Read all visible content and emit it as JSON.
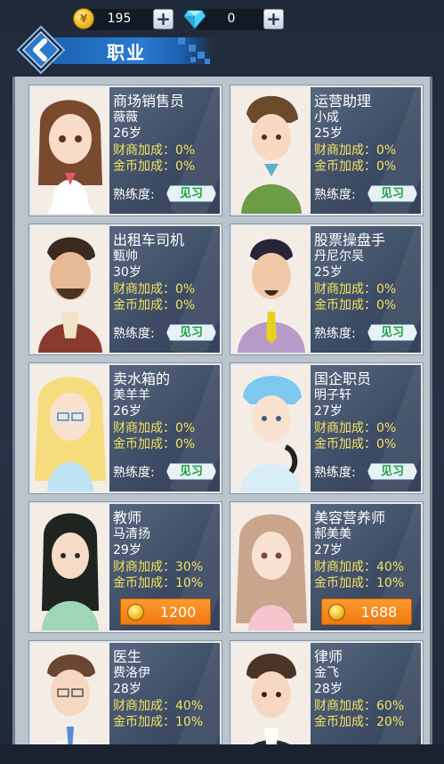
{
  "header": {
    "gold": "195",
    "diamond": "0",
    "title": "职业"
  },
  "jobs": [
    {
      "job": "商场销售员",
      "name": "薇薇",
      "age": "26岁",
      "stat1": "财商加成：0%",
      "stat2": "金币加成：0%",
      "prof_label": "熟练度:",
      "badge": "见习"
    },
    {
      "job": "运营助理",
      "name": "小成",
      "age": "25岁",
      "stat1": "财商加成：0%",
      "stat2": "金币加成：0%",
      "prof_label": "熟练度:",
      "badge": "见习"
    },
    {
      "job": "出租车司机",
      "name": "甄帅",
      "age": "30岁",
      "stat1": "财商加成：0%",
      "stat2": "金币加成：0%",
      "prof_label": "熟练度:",
      "badge": "见习"
    },
    {
      "job": "股票操盘手",
      "name": "丹尼尔吴",
      "age": "25岁",
      "stat1": "财商加成：0%",
      "stat2": "金币加成：0%",
      "prof_label": "熟练度:",
      "badge": "见习"
    },
    {
      "job": "卖水箱的",
      "name": "美羊羊",
      "age": "26岁",
      "stat1": "财商加成：0%",
      "stat2": "金币加成：0%",
      "prof_label": "熟练度:",
      "badge": "见习"
    },
    {
      "job": "国企职员",
      "name": "明子轩",
      "age": "27岁",
      "stat1": "财商加成：0%",
      "stat2": "金币加成：0%",
      "prof_label": "熟练度:",
      "badge": "见习"
    },
    {
      "job": "教师",
      "name": "马清扬",
      "age": "29岁",
      "stat1": "财商加成：30%",
      "stat2": "金币加成：10%",
      "price": "1200"
    },
    {
      "job": "美容营养师",
      "name": "郝美美",
      "age": "27岁",
      "stat1": "财商加成：40%",
      "stat2": "金币加成：10%",
      "price": "1688"
    },
    {
      "job": "医生",
      "name": "费洛伊",
      "age": "28岁",
      "stat1": "财商加成：40%",
      "stat2": "金币加成：10%"
    },
    {
      "job": "律师",
      "name": "金飞",
      "age": "28岁",
      "stat1": "财商加成：60%",
      "stat2": "金币加成：20%"
    }
  ],
  "colors": {
    "accent_yellow": "#f3e260",
    "badge_green": "#1a9e3a",
    "price_orange": "#f07a10",
    "banner_blue": "#2a7bd0"
  }
}
